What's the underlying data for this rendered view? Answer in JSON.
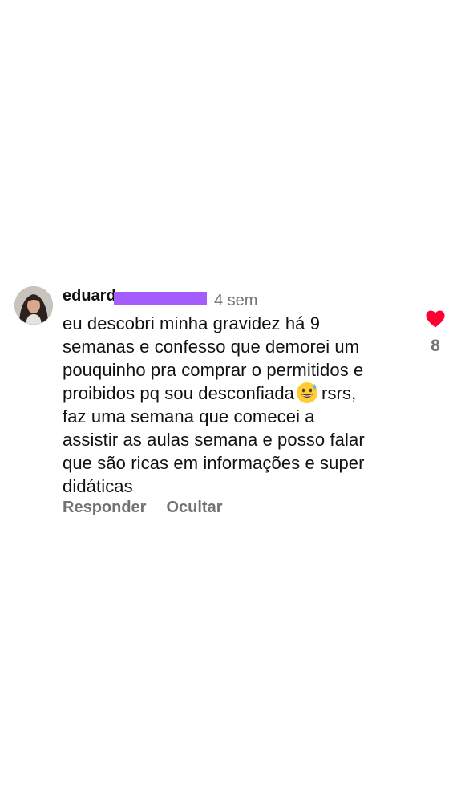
{
  "comment": {
    "username_visible": "eduard",
    "timestamp": "4 sem",
    "body_lines": [
      "eu descobri minha gravidez há 9",
      "semanas e confesso que demorei um",
      "pouquinho pra comprar o permitidos e",
      "proibidos pq sou desconfiada",
      "rsrs,",
      "faz uma semana que comecei a",
      "assistir as aulas semana e posso falar",
      "que são ricas em informações e super",
      "didáticas"
    ],
    "emoji_icon": "grinning-face-with-sweat-emoji",
    "actions": {
      "reply_label": "Responder",
      "hide_label": "Ocultar"
    },
    "likes": {
      "count": "8",
      "liked": true,
      "icon": "heart-icon"
    }
  },
  "colors": {
    "redaction": "#a45cff",
    "heart": "#ff0033",
    "secondary_text": "#737373",
    "primary_text": "#111111"
  }
}
